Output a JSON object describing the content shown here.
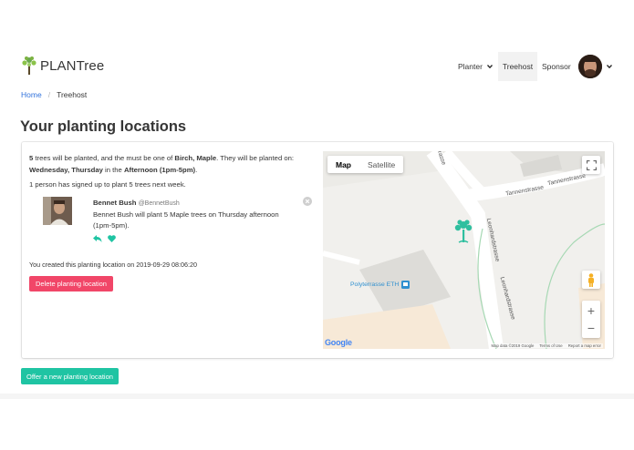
{
  "brand": {
    "name": "PLANTree"
  },
  "nav": {
    "planter": "Planter",
    "treehost": "Treehost",
    "sponsor": "Sponsor"
  },
  "breadcrumb": {
    "home": "Home",
    "separator": "/",
    "current": "Treehost"
  },
  "page": {
    "title": "Your planting locations"
  },
  "location": {
    "tree_count": "5",
    "text_1": " trees will be planted, and the must be one of ",
    "species": "Birch, Maple",
    "text_2": ". They will be planted on: ",
    "days": "Wednesday, Thursday",
    "text_3": " in the ",
    "time": "Afternoon (1pm-5pm)",
    "text_4": ".",
    "signups": "1 person has signed up to plant 5 trees next week.",
    "signup": {
      "name": "Bennet Bush",
      "handle": "@BennetBush",
      "message": "Bennet Bush will plant 5 Maple trees on Thursday afternoon (1pm-5pm)."
    },
    "created": "You created this planting location on 2019-09-29 08:06:20",
    "delete_label": "Delete planting location"
  },
  "map": {
    "type_map": "Map",
    "type_satellite": "Satellite",
    "street_1": "Tannenstrasse",
    "street_2": "Tannenstrasse",
    "street_3": "Leonhardstrasse",
    "street_4": "Leonhardstrasse",
    "street_5": "rasse",
    "poi": "Polyterrasse ETH",
    "zoom_in": "+",
    "zoom_out": "−",
    "logo": "Google",
    "attribution": "Map data ©2019 Google",
    "terms": "Terms of Use",
    "report": "Report a map error"
  },
  "offer_label": "Offer a new planting location",
  "colors": {
    "primary": "#1fc4a3",
    "danger": "#f14668",
    "link": "#3273dc",
    "tree": "#2fbf9f"
  }
}
